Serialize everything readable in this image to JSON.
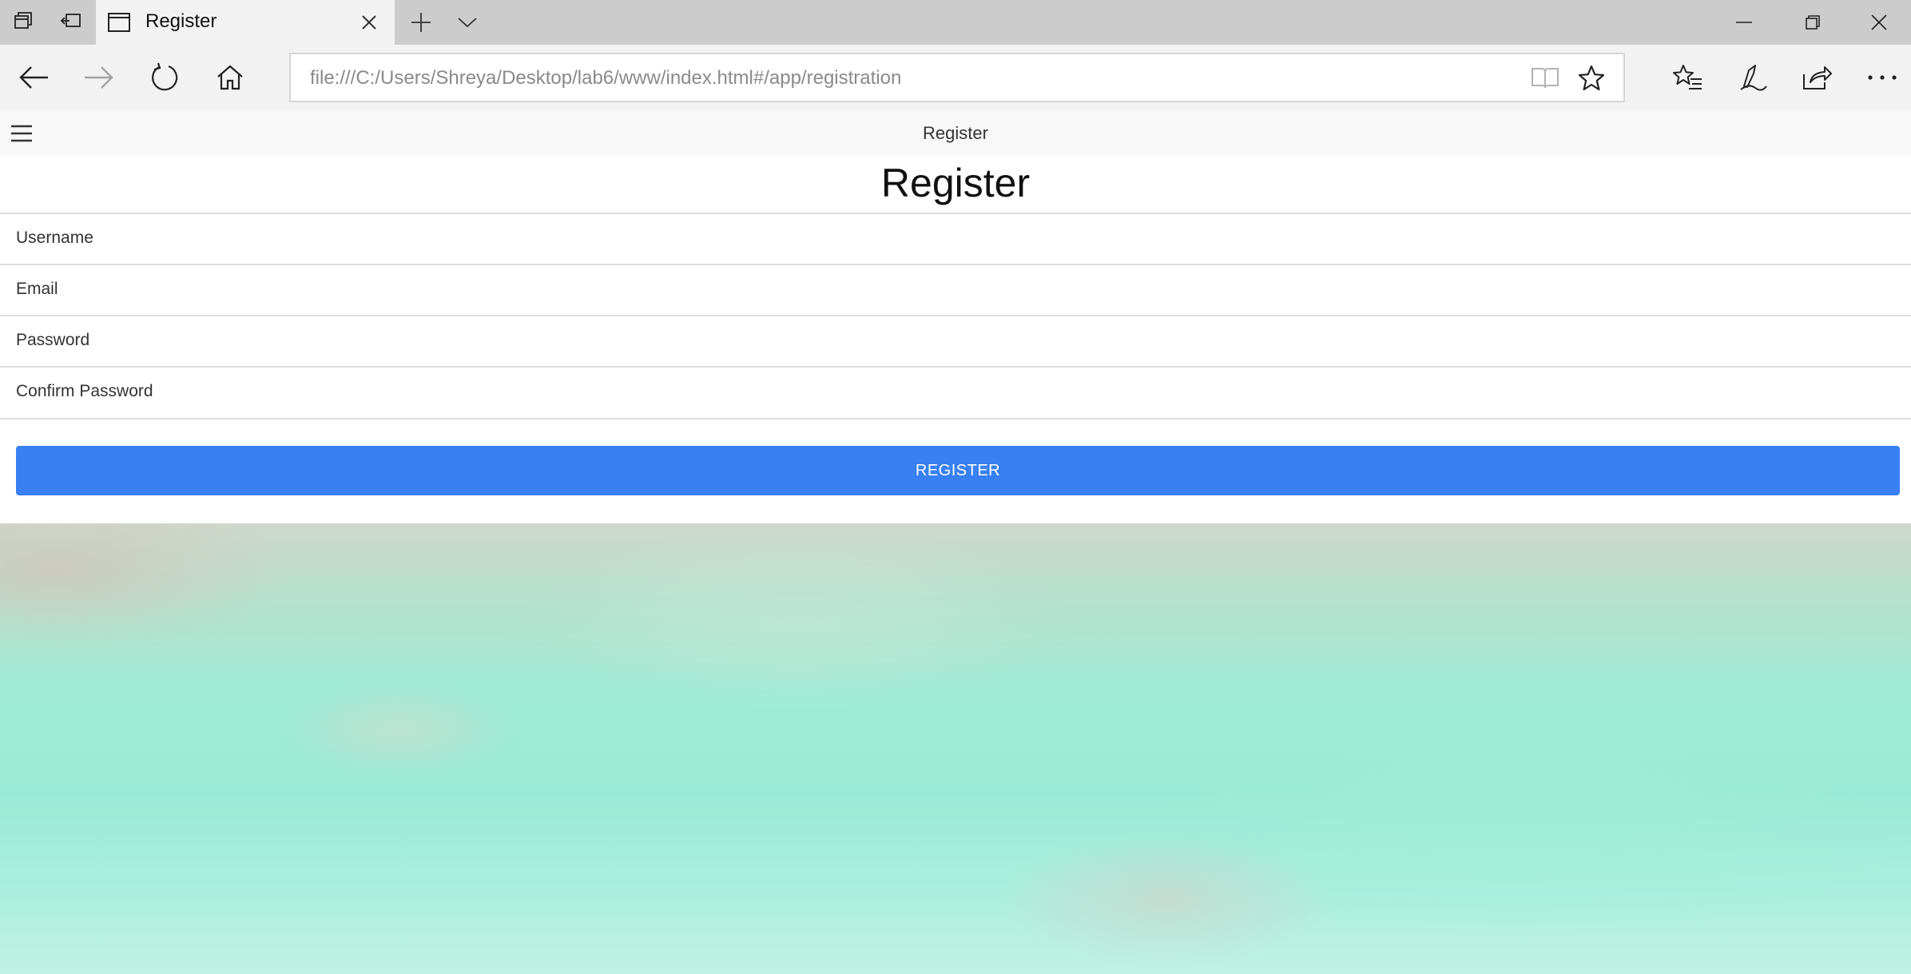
{
  "browser": {
    "tab_title": "Register",
    "url": "file:///C:/Users/Shreya/Desktop/lab6/www/index.html#/app/registration"
  },
  "app": {
    "header_title": "Register",
    "page_title": "Register",
    "form": {
      "username_placeholder": "Username",
      "email_placeholder": "Email",
      "password_placeholder": "Password",
      "confirm_password_placeholder": "Confirm Password",
      "submit_label": "REGISTER"
    }
  },
  "colors": {
    "accent": "#3880f3",
    "chrome_tabstrip": "#cccccc",
    "chrome_bar": "#f2f2f2",
    "background_image": "#a0ecd6"
  }
}
